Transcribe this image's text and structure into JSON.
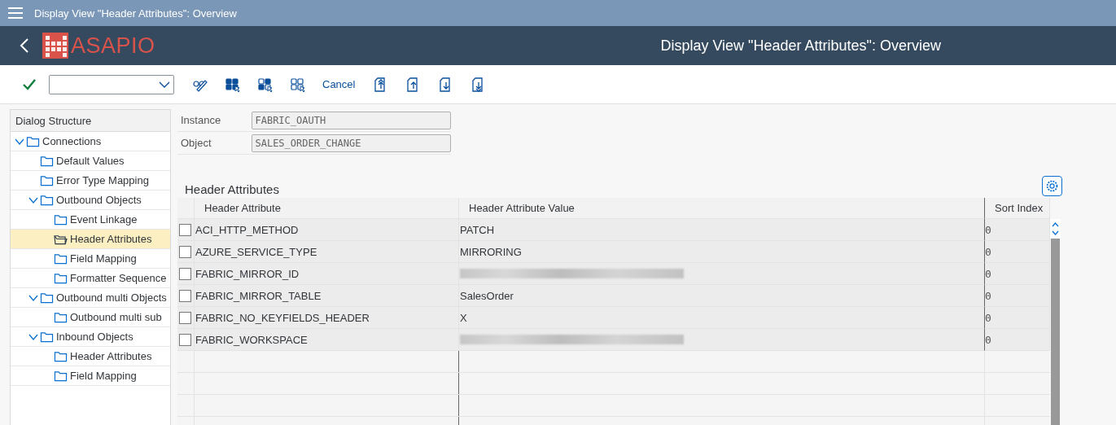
{
  "window": {
    "title": "Display View \"Header Attributes\": Overview"
  },
  "header": {
    "logo_text": "ASAPIO",
    "title": "Display View \"Header Attributes\": Overview"
  },
  "toolbar": {
    "cancel_button": "Cancel"
  },
  "dialog_structure": {
    "title": "Dialog Structure",
    "items": [
      {
        "label": "Connections",
        "expanded": true,
        "selected": false,
        "children": [
          {
            "label": "Default Values",
            "selected": false
          },
          {
            "label": "Error Type Mapping",
            "selected": false
          },
          {
            "label": "Outbound  Objects",
            "expanded": true,
            "selected": false,
            "children": [
              {
                "label": "Event Linkage",
                "selected": false
              },
              {
                "label": "Header Attributes",
                "selected": true
              },
              {
                "label": "Field Mapping",
                "selected": false
              },
              {
                "label": "Formatter Sequence",
                "selected": false
              }
            ]
          },
          {
            "label": "Outbound multi Objects",
            "expanded": true,
            "selected": false,
            "children": [
              {
                "label": "Outbound multi sub",
                "selected": false
              }
            ]
          },
          {
            "label": "Inbound Objects",
            "expanded": true,
            "selected": false,
            "children": [
              {
                "label": "Header Attributes",
                "selected": false
              },
              {
                "label": "Field Mapping",
                "selected": false
              }
            ]
          }
        ]
      }
    ]
  },
  "fields": [
    {
      "label": "Instance",
      "value": "FABRIC_OAUTH"
    },
    {
      "label": "Object",
      "value": "SALES_ORDER_CHANGE"
    }
  ],
  "table": {
    "title": "Header Attributes",
    "columns": [
      "Header Attribute",
      "Header Attribute Value",
      "Sort Index"
    ],
    "rows": [
      {
        "checked": false,
        "attribute": "ACI_HTTP_METHOD",
        "value": "PATCH",
        "sort_index": "0"
      },
      {
        "checked": false,
        "attribute": "AZURE_SERVICE_TYPE",
        "value": "MIRRORING",
        "sort_index": "0"
      },
      {
        "checked": false,
        "attribute": "FABRIC_MIRROR_ID",
        "sort_index": "0"
      },
      {
        "checked": false,
        "attribute": "FABRIC_MIRROR_TABLE",
        "value": "SalesOrder",
        "sort_index": "0"
      },
      {
        "checked": false,
        "attribute": "FABRIC_NO_KEYFIELDS_HEADER",
        "value": "X",
        "sort_index": "0"
      },
      {
        "checked": false,
        "attribute": "FABRIC_WORKSPACE",
        "sort_index": "0"
      }
    ]
  }
}
